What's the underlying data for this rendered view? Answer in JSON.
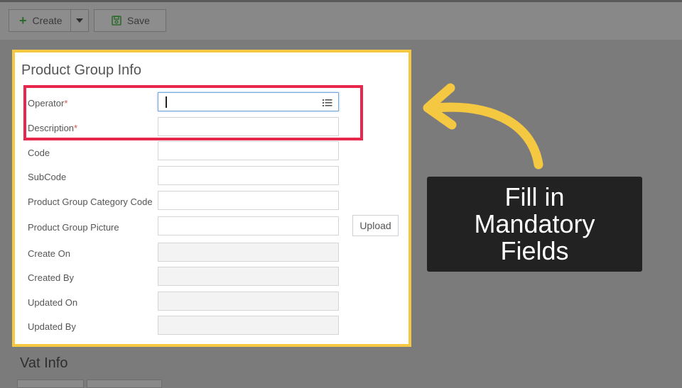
{
  "toolbar": {
    "create_label": "Create",
    "save_label": "Save"
  },
  "panel": {
    "title": "Product Group Info",
    "fields": [
      {
        "label": "Operator",
        "required": "*",
        "value": "",
        "readonly": false
      },
      {
        "label": "Description",
        "required": "*",
        "value": "",
        "readonly": false
      },
      {
        "label": "Code",
        "required": "",
        "value": "",
        "readonly": false
      },
      {
        "label": "SubCode",
        "required": "",
        "value": "",
        "readonly": false
      },
      {
        "label": "Product Group Category Code",
        "required": "",
        "value": "",
        "readonly": false
      },
      {
        "label": "Product Group Picture",
        "required": "",
        "value": "",
        "readonly": false
      },
      {
        "label": "Create On",
        "required": "",
        "value": "",
        "readonly": true
      },
      {
        "label": "Created By",
        "required": "",
        "value": "",
        "readonly": true
      },
      {
        "label": "Updated On",
        "required": "",
        "value": "",
        "readonly": true
      },
      {
        "label": "Updated By",
        "required": "",
        "value": "",
        "readonly": true
      }
    ],
    "upload_label": "Upload"
  },
  "vat": {
    "title": "Vat Info"
  },
  "callout": {
    "text": "Fill in\nMandatory\nFields"
  },
  "colors": {
    "highlight_panel": "#f5c842",
    "highlight_required": "#e8274d",
    "arrow": "#f5c842",
    "callout_bg": "#222222"
  },
  "icons": {
    "create": "plus-icon",
    "dropdown": "chevron-down-icon",
    "save": "floppy-disk-icon",
    "operator_lookup": "list-icon",
    "annotation": "curved-arrow-icon"
  }
}
